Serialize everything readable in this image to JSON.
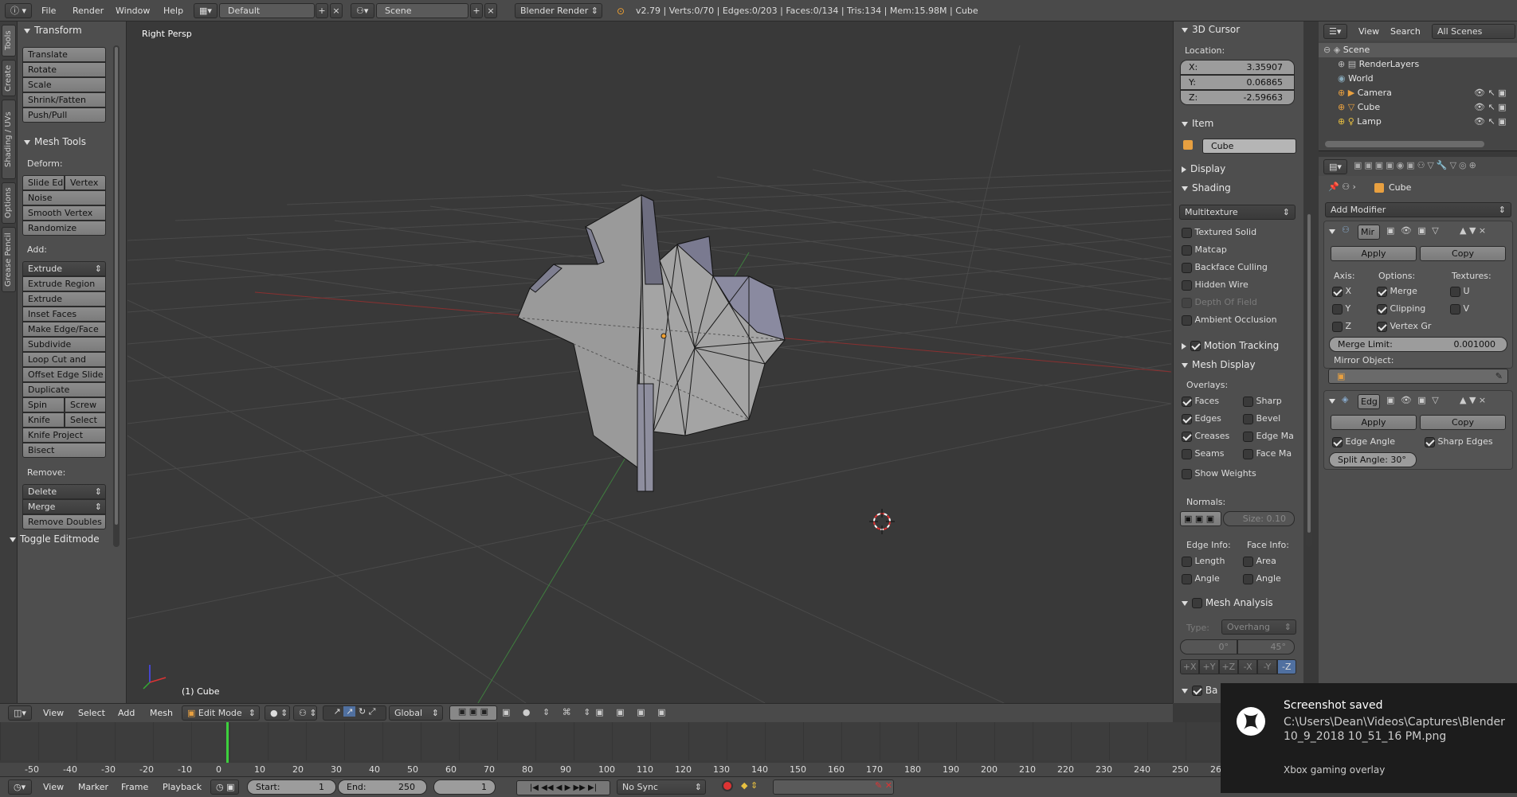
{
  "topbar": {
    "menus": [
      "File",
      "Render",
      "Window",
      "Help"
    ],
    "layout": "Default",
    "scene": "Scene",
    "engine": "Blender Render",
    "stats": "v2.79 | Verts:0/70 | Edges:0/203 | Faces:0/134 | Tris:134 | Mem:15.98M | Cube"
  },
  "tabs": [
    "Tools",
    "Create",
    "Shading / UVs",
    "Options",
    "Grease Pencil"
  ],
  "toolshelf": {
    "transform_title": "Transform",
    "transform": [
      "Translate",
      "Rotate",
      "Scale",
      "Shrink/Fatten",
      "Push/Pull"
    ],
    "meshtools_title": "Mesh Tools",
    "deform_label": "Deform:",
    "slide_edge": "Slide Ed",
    "vertex": "Vertex",
    "deform": [
      "Noise",
      "Smooth Vertex",
      "Randomize"
    ],
    "add_label": "Add:",
    "extrude": "Extrude",
    "add": [
      "Extrude Region",
      "Extrude Individual",
      "Inset Faces",
      "Make Edge/Face",
      "Subdivide",
      "Loop Cut and Slide",
      "Offset Edge Slide",
      "Duplicate"
    ],
    "spin": "Spin",
    "screw": "Screw",
    "knife": "Knife",
    "select": "Select",
    "knife_project": "Knife Project",
    "bisect": "Bisect",
    "remove_label": "Remove:",
    "delete": "Delete",
    "merge": "Merge",
    "remove_doubles": "Remove Doubles",
    "toggle": "Toggle Editmode"
  },
  "viewport": {
    "view_name": "Right Persp",
    "object_label": "(1) Cube"
  },
  "npanel": {
    "cursor_title": "3D Cursor",
    "location_label": "Location:",
    "x_label": "X:",
    "x": "3.35907",
    "y_label": "Y:",
    "y": "0.06865",
    "z_label": "Z:",
    "z": "-2.59663",
    "item_title": "Item",
    "item_name": "Cube",
    "display_title": "Display",
    "shading_title": "Shading",
    "shading_mode": "Multitexture",
    "shading_opts": [
      "Textured Solid",
      "Matcap",
      "Backface Culling",
      "Hidden Wire",
      "Depth Of Field",
      "Ambient Occlusion"
    ],
    "motion_tracking": "Motion Tracking",
    "mesh_display": "Mesh Display",
    "overlays_label": "Overlays:",
    "overlays_left": [
      "Faces",
      "Edges",
      "Creases",
      "Seams"
    ],
    "overlays_right": [
      "Sharp",
      "Bevel",
      "Edge Ma",
      "Face Ma"
    ],
    "show_weights": "Show Weights",
    "normals_label": "Normals:",
    "size": "Size:  0.10",
    "edge_info": "Edge Info:",
    "face_info": "Face Info:",
    "edge_opts": [
      "Length",
      "Angle"
    ],
    "face_opts": [
      "Area",
      "Angle"
    ],
    "mesh_analysis": "Mesh Analysis",
    "type_label": "Type:",
    "type_value": "Overhang",
    "angle_min": "0°",
    "angle_max": "45°",
    "axes": [
      "+X",
      "+Y",
      "+Z",
      "-X",
      "-Y",
      "-Z"
    ],
    "ba": "Ba"
  },
  "outliner": {
    "view": "View",
    "search": "Search",
    "scenes": "All Scenes",
    "items": [
      "Scene",
      "RenderLayers",
      "World",
      "Camera",
      "Cube",
      "Lamp"
    ]
  },
  "props": {
    "object": "Cube",
    "add_modifier": "Add Modifier",
    "mirror_name": "Mir",
    "apply": "Apply",
    "copy": "Copy",
    "axis_label": "Axis:",
    "options_label": "Options:",
    "textures_label": "Textures:",
    "axes": [
      "X",
      "Y",
      "Z"
    ],
    "options": [
      "Merge",
      "Clipping",
      "Vertex Gr"
    ],
    "textures": [
      "U",
      "V"
    ],
    "merge_limit_label": "Merge Limit:",
    "merge_limit": "0.001000",
    "mirror_object": "Mirror Object:",
    "edge_name": "Edg",
    "edge_angle": "Edge Angle",
    "sharp_edges": "Sharp Edges",
    "split_angle": "Split Angle: 30°"
  },
  "vpheader": {
    "menus": [
      "View",
      "Select",
      "Add",
      "Mesh"
    ],
    "mode": "Edit Mode",
    "orientation": "Global"
  },
  "timeline": {
    "ticks": [
      "-50",
      "-40",
      "-30",
      "-20",
      "-10",
      "0",
      "10",
      "20",
      "30",
      "40",
      "50",
      "60",
      "70",
      "80",
      "90",
      "100",
      "110",
      "120",
      "130",
      "140",
      "150",
      "160",
      "170",
      "180",
      "190",
      "200",
      "210",
      "220",
      "230",
      "240",
      "250",
      "26"
    ],
    "menus": [
      "View",
      "Marker",
      "Frame",
      "Playback"
    ],
    "start": "Start:",
    "start_v": "1",
    "end": "End:",
    "end_v": "250",
    "current": "1",
    "sync": "No Sync"
  },
  "toast": {
    "title": "Screenshot saved",
    "path": "C:\\Users\\Dean\\Videos\\Captures\\Blender 10_9_2018 10_51_16 PM.png",
    "source": "Xbox gaming overlay"
  }
}
